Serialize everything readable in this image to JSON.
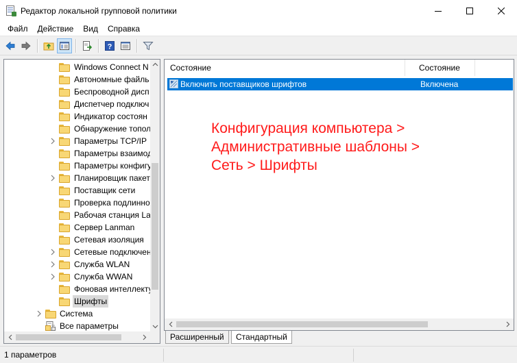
{
  "window": {
    "title": "Редактор локальной групповой политики"
  },
  "menu": {
    "items": [
      "Файл",
      "Действие",
      "Вид",
      "Справка"
    ]
  },
  "toolbar": {
    "buttons": [
      "back-icon",
      "forward-icon",
      "up-folder-icon",
      "show-hide-tree-icon",
      "export-list-icon",
      "help-icon",
      "properties-icon",
      "filter-icon"
    ]
  },
  "tree": {
    "items": [
      {
        "label": "Windows Connect N",
        "has_children": false
      },
      {
        "label": "Автономные файль",
        "has_children": false
      },
      {
        "label": "Беспроводной дисп",
        "has_children": false
      },
      {
        "label": "Диспетчер подключ",
        "has_children": false
      },
      {
        "label": "Индикатор состоян",
        "has_children": false
      },
      {
        "label": "Обнаружение топол",
        "has_children": false
      },
      {
        "label": "Параметры TCP/IP",
        "has_children": true
      },
      {
        "label": "Параметры взаимод",
        "has_children": false
      },
      {
        "label": "Параметры конфигу",
        "has_children": false
      },
      {
        "label": "Планировщик пакет",
        "has_children": true
      },
      {
        "label": "Поставщик сети",
        "has_children": false
      },
      {
        "label": "Проверка подлинно",
        "has_children": false
      },
      {
        "label": "Рабочая станция Lar",
        "has_children": false
      },
      {
        "label": "Сервер Lanman",
        "has_children": false
      },
      {
        "label": "Сетевая изоляция",
        "has_children": false
      },
      {
        "label": "Сетевые подключен",
        "has_children": true
      },
      {
        "label": "Служба WLAN",
        "has_children": true
      },
      {
        "label": "Служба WWAN",
        "has_children": true
      },
      {
        "label": "Фоновая интеллекту",
        "has_children": false
      },
      {
        "label": "Шрифты",
        "has_children": false,
        "selected": true
      }
    ],
    "system_label": "Система",
    "all_params_label": "Все параметры"
  },
  "list": {
    "headers": [
      "Состояние",
      "Состояние"
    ],
    "rows": [
      {
        "setting": "Включить поставщиков шрифтов",
        "state": "Включена",
        "selected": true
      }
    ]
  },
  "annotation": {
    "text": "Конфигурация компьютера >\nАдминистративные шаблоны >\nСеть > Шрифты",
    "color": "#ff1a1a"
  },
  "tabs": {
    "extended": "Расширенный",
    "standard": "Стандартный",
    "active": "Стандартный"
  },
  "status": {
    "text": "1 параметров"
  },
  "colors": {
    "selection": "#0078d7",
    "tree_selection": "#d9d9d9",
    "folder": "#f8d775"
  }
}
